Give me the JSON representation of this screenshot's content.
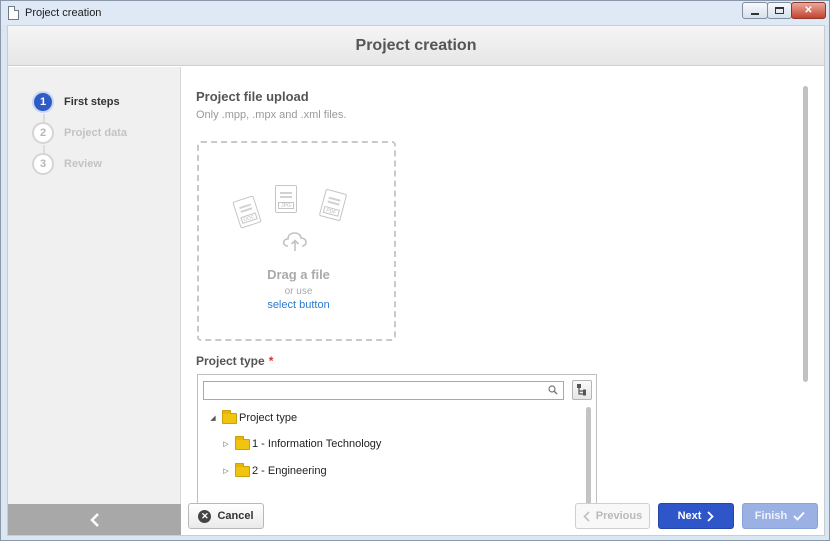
{
  "window": {
    "title": "Project creation"
  },
  "header": {
    "title": "Project creation"
  },
  "steps": [
    {
      "number": "1",
      "label": "First steps",
      "state": "active"
    },
    {
      "number": "2",
      "label": "Project data",
      "state": "pending"
    },
    {
      "number": "3",
      "label": "Review",
      "state": "pending"
    }
  ],
  "upload": {
    "title": "Project file upload",
    "hint": "Only .mpp, .mpx and .xml files.",
    "file_type_icons": [
      "DOC",
      "JPG",
      "PDF"
    ],
    "drag_text": "Drag a file",
    "or_use_text": "or use",
    "select_link": "select button"
  },
  "project_type": {
    "label": "Project type",
    "required_mark": "*",
    "search_value": "",
    "tree": [
      {
        "label": "Project type",
        "level": 0,
        "expanded": true
      },
      {
        "label": "1 - Information Technology",
        "level": 1,
        "expanded": false
      },
      {
        "label": "2 - Engineering",
        "level": 1,
        "expanded": false
      }
    ]
  },
  "footer": {
    "cancel_label": "Cancel",
    "previous_label": "Previous",
    "next_label": "Next",
    "finish_label": "Finish"
  },
  "colors": {
    "accent": "#2f56c8",
    "disabled_accent": "#9bb1e4",
    "link": "#2b7bcf",
    "required": "#d93030"
  }
}
